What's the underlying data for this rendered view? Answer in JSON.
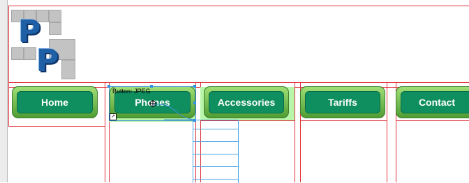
{
  "nav": {
    "buttons": [
      {
        "label": "Home"
      },
      {
        "label": "Phones"
      },
      {
        "label": "Accessories"
      },
      {
        "label": "Tariffs"
      },
      {
        "label": "Contact"
      }
    ]
  },
  "selection": {
    "label": "Button: JPEG"
  },
  "logo": {
    "letter_top": "P",
    "letter_bottom": "P"
  },
  "colors": {
    "button_fill": "#0f8f60",
    "button_bevel": "#7fcc55",
    "guide_lines": "#e0303a",
    "selection": "#3b8fd8"
  }
}
